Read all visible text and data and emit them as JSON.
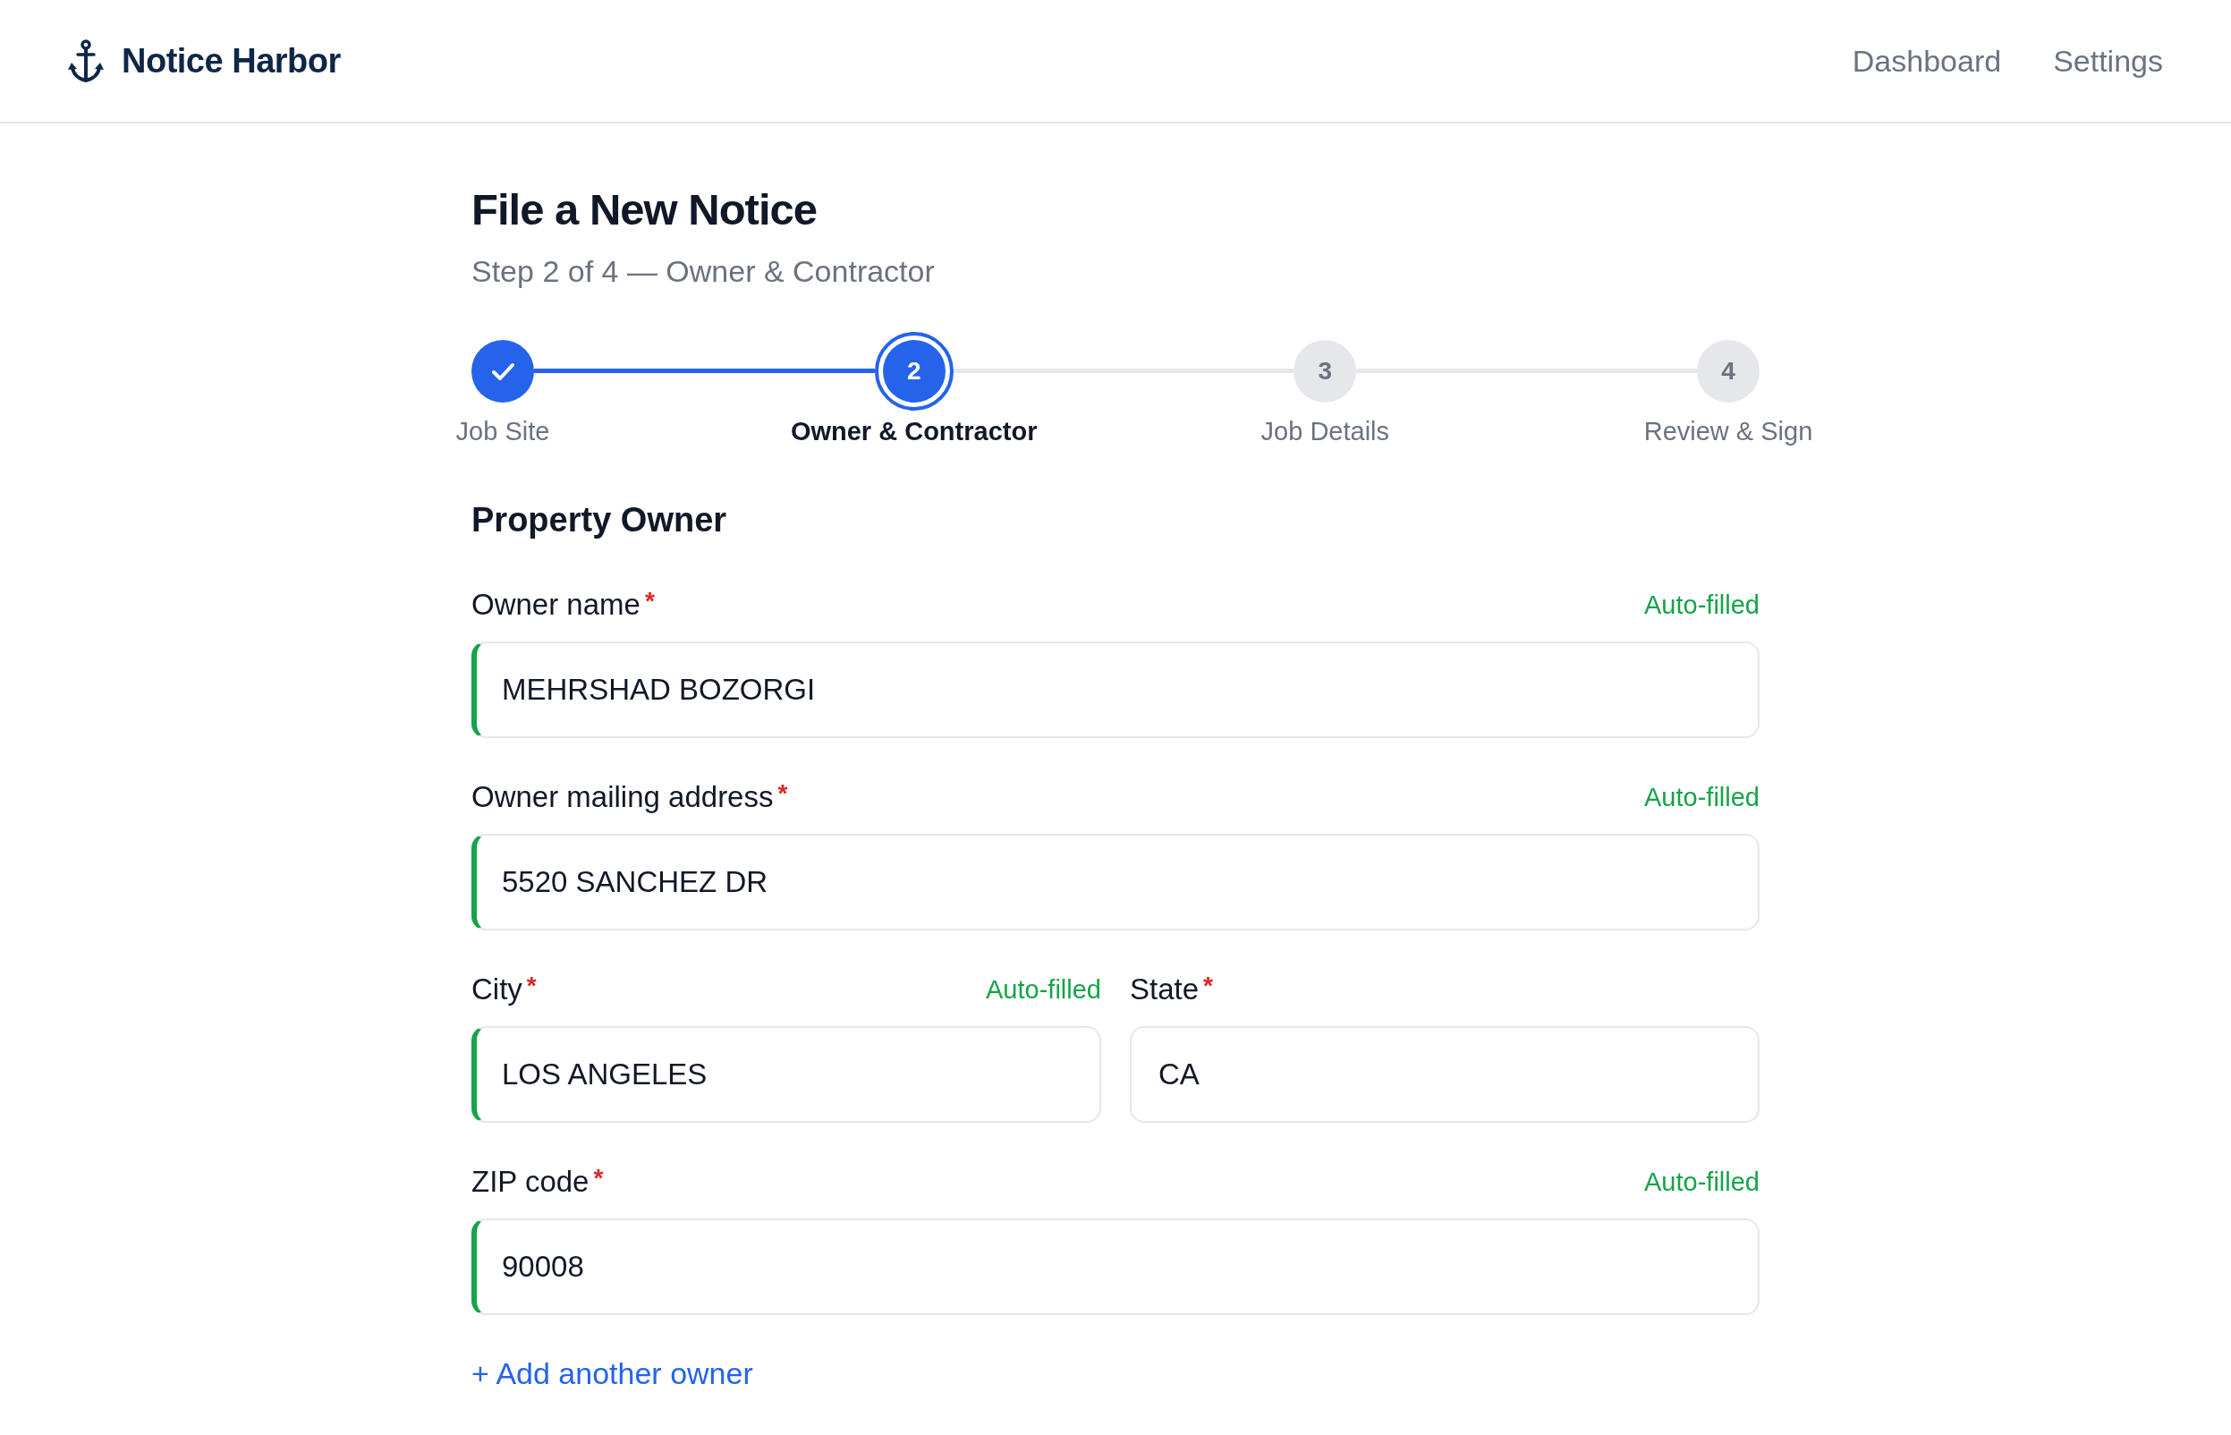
{
  "header": {
    "brand": "Notice Harbor",
    "nav": [
      {
        "label": "Dashboard"
      },
      {
        "label": "Settings"
      }
    ]
  },
  "page": {
    "title": "File a New Notice",
    "subtitle": "Step 2 of 4 — Owner & Contractor"
  },
  "steps": [
    {
      "label": "Job Site",
      "completed": true,
      "current": false
    },
    {
      "label": "Owner & Contractor",
      "number": "2",
      "completed": false,
      "current": true
    },
    {
      "label": "Job Details",
      "number": "3",
      "completed": false,
      "current": false
    },
    {
      "label": "Review & Sign",
      "number": "4",
      "completed": false,
      "current": false
    }
  ],
  "section": {
    "title": "Property Owner",
    "rows": [
      {
        "fields": [
          {
            "label": "Owner name",
            "required_mark": "*",
            "note": "Auto-filled",
            "auto_filled": true,
            "value": "MEHRSHAD BOZORGI"
          }
        ]
      },
      {
        "fields": [
          {
            "label": "Owner mailing address",
            "required_mark": "*",
            "note": "Auto-filled",
            "auto_filled": true,
            "value": "5520 SANCHEZ DR"
          }
        ]
      },
      {
        "fields": [
          {
            "label": "City",
            "required_mark": "*",
            "note": "Auto-filled",
            "auto_filled": true,
            "value": "LOS ANGELES"
          },
          {
            "label": "State",
            "required_mark": "*",
            "auto_filled": false,
            "value": "CA"
          }
        ]
      },
      {
        "fields": [
          {
            "label": "ZIP code",
            "required_mark": "*",
            "note": "Auto-filled",
            "auto_filled": true,
            "value": "90008"
          }
        ]
      }
    ],
    "add_link": "+ Add another owner"
  }
}
